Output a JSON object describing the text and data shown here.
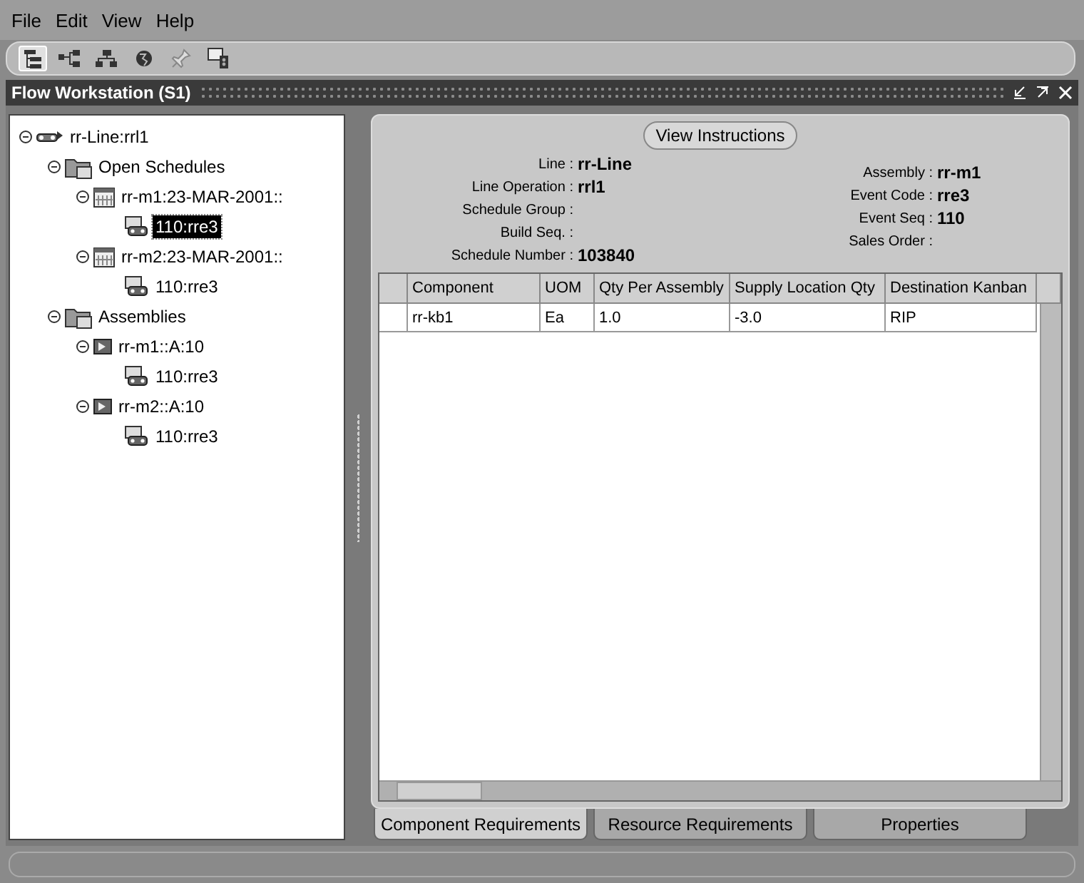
{
  "menu": [
    "File",
    "Edit",
    "View",
    "Help"
  ],
  "toolbar": [
    {
      "kind": "tree",
      "selected": true
    },
    {
      "kind": "network",
      "selected": false
    },
    {
      "kind": "hierarchy",
      "selected": false
    },
    {
      "kind": "globe",
      "selected": false
    },
    {
      "kind": "pin",
      "selected": false
    },
    {
      "kind": "monitor",
      "selected": false
    }
  ],
  "window": {
    "title": "Flow Workstation  (S1)"
  },
  "tree": [
    {
      "label": "rr-Line:rrl1",
      "kind": "line",
      "expanded": true,
      "selected": false,
      "children": [
        {
          "label": "Open Schedules",
          "kind": "folder",
          "expanded": true,
          "selected": false,
          "children": [
            {
              "label": "rr-m1:23-MAR-2001::",
              "kind": "calendar",
              "expanded": true,
              "selected": false,
              "children": [
                {
                  "label": "110:rre3",
                  "kind": "event",
                  "selected": true
                }
              ]
            },
            {
              "label": "rr-m2:23-MAR-2001::",
              "kind": "calendar",
              "expanded": true,
              "selected": false,
              "children": [
                {
                  "label": "110:rre3",
                  "kind": "event",
                  "selected": false
                }
              ]
            }
          ]
        },
        {
          "label": "Assemblies",
          "kind": "folder",
          "expanded": true,
          "selected": false,
          "children": [
            {
              "label": "rr-m1::A:10",
              "kind": "assembly",
              "expanded": true,
              "selected": false,
              "children": [
                {
                  "label": "110:rre3",
                  "kind": "event",
                  "selected": false
                }
              ]
            },
            {
              "label": "rr-m2::A:10",
              "kind": "assembly",
              "expanded": true,
              "selected": false,
              "children": [
                {
                  "label": "110:rre3",
                  "kind": "event",
                  "selected": false
                }
              ]
            }
          ]
        }
      ]
    }
  ],
  "view_instructions_button": "View Instructions",
  "details_left": [
    {
      "label": "Line :",
      "value": "rr-Line"
    },
    {
      "label": "Line Operation :",
      "value": "rrl1"
    },
    {
      "label": "Schedule Group :"
    },
    {
      "label": "Build Seq. :"
    },
    {
      "label": "Schedule Number :",
      "value": "103840"
    }
  ],
  "details_right": [
    {
      "label": "Assembly :",
      "value": "rr-m1"
    },
    {
      "label": "Event Code :",
      "value": "rre3"
    },
    {
      "label": "Event Seq :",
      "value": "110"
    },
    {
      "label": "Sales Order :"
    }
  ],
  "table": {
    "columns": [
      "Component",
      "UOM",
      "Qty Per Assembly",
      "Supply Location Qty",
      "Destination Kanban"
    ],
    "rows": [
      [
        "rr-kb1",
        "Ea",
        "1.0",
        "-3.0",
        "RIP"
      ]
    ]
  },
  "tabs": [
    {
      "label": "Component Requirements",
      "selected": true
    },
    {
      "label": "Resource Requirements",
      "selected": false
    },
    {
      "label": "Properties",
      "selected": false
    }
  ]
}
